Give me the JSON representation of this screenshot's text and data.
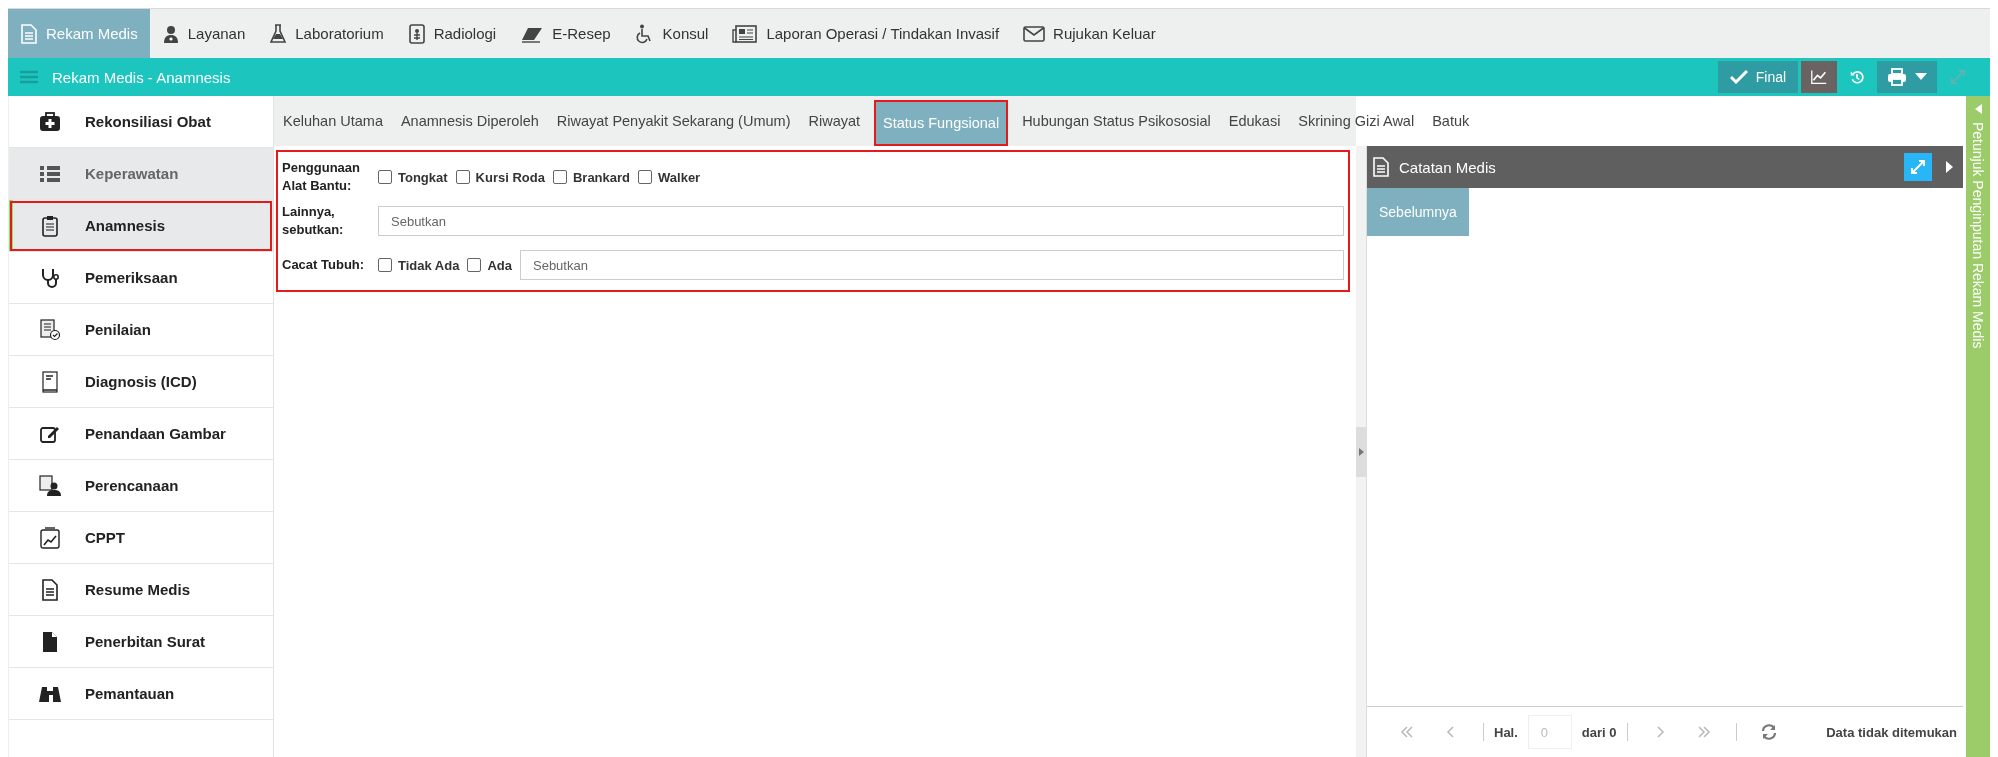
{
  "top_nav": [
    {
      "label": "Rekam Medis",
      "selected": true
    },
    {
      "label": "Layanan",
      "selected": false
    },
    {
      "label": "Laboratorium",
      "selected": false
    },
    {
      "label": "Radiologi",
      "selected": false
    },
    {
      "label": "E-Resep",
      "selected": false
    },
    {
      "label": "Konsul",
      "selected": false
    },
    {
      "label": "Laporan Operasi / Tindakan Invasif",
      "selected": false
    },
    {
      "label": "Rujukan Keluar",
      "selected": false
    }
  ],
  "header": {
    "title": "Rekam Medis - Anamnesis",
    "final_button": "Final"
  },
  "sidebar": {
    "items": [
      {
        "label": "Rekonsiliasi Obat",
        "selected": false,
        "disabled": false
      },
      {
        "label": "Keperawatan",
        "selected": false,
        "disabled": true
      },
      {
        "label": "Anamnesis",
        "selected": true,
        "disabled": false
      },
      {
        "label": "Pemeriksaan",
        "selected": false,
        "disabled": false
      },
      {
        "label": "Penilaian",
        "selected": false,
        "disabled": false
      },
      {
        "label": "Diagnosis (ICD)",
        "selected": false,
        "disabled": false
      },
      {
        "label": "Penandaan Gambar",
        "selected": false,
        "disabled": false
      },
      {
        "label": "Perencanaan",
        "selected": false,
        "disabled": false
      },
      {
        "label": "CPPT",
        "selected": false,
        "disabled": false
      },
      {
        "label": "Resume Medis",
        "selected": false,
        "disabled": false
      },
      {
        "label": "Penerbitan Surat",
        "selected": false,
        "disabled": false
      },
      {
        "label": "Pemantauan",
        "selected": false,
        "disabled": false
      }
    ]
  },
  "tabs": [
    {
      "label": "Keluhan Utama",
      "selected": false
    },
    {
      "label": "Anamnesis Diperoleh",
      "selected": false
    },
    {
      "label": "Riwayat Penyakit Sekarang (Umum)",
      "selected": false
    },
    {
      "label": "Riwayat",
      "selected": false
    },
    {
      "label": "Status Fungsional",
      "selected": true
    },
    {
      "label": "Hubungan Status Psikososial",
      "selected": false
    },
    {
      "label": "Edukasi",
      "selected": false
    },
    {
      "label": "Skrining Gizi Awal",
      "selected": false
    },
    {
      "label": "Batuk",
      "selected": false
    }
  ],
  "form": {
    "rows": [
      {
        "kind": "checks",
        "label": "Penggunaan Alat Bantu:",
        "options": [
          {
            "label": "Tongkat",
            "checked": false
          },
          {
            "label": "Kursi Roda",
            "checked": false
          },
          {
            "label": "Brankard",
            "checked": false
          },
          {
            "label": "Walker",
            "checked": false
          }
        ]
      },
      {
        "kind": "text",
        "label": "Lainnya, sebutkan:",
        "placeholder": "Sebutkan"
      },
      {
        "kind": "checks_text",
        "label": "Cacat Tubuh:",
        "options": [
          {
            "label": "Tidak Ada",
            "checked": false
          },
          {
            "label": "Ada",
            "checked": false
          }
        ],
        "placeholder": "Sebutkan"
      }
    ]
  },
  "notes_panel": {
    "title": "Catatan Medis",
    "tabs": [
      {
        "label": "Sebelumnya",
        "selected": true
      }
    ],
    "pager": {
      "page_label": "Hal.",
      "page_value": "0",
      "of_label": "dari 0",
      "status": "Data tidak ditemukan"
    }
  },
  "side_drawer": {
    "title": "Petunjuk Penginputan Rekam Medis"
  }
}
